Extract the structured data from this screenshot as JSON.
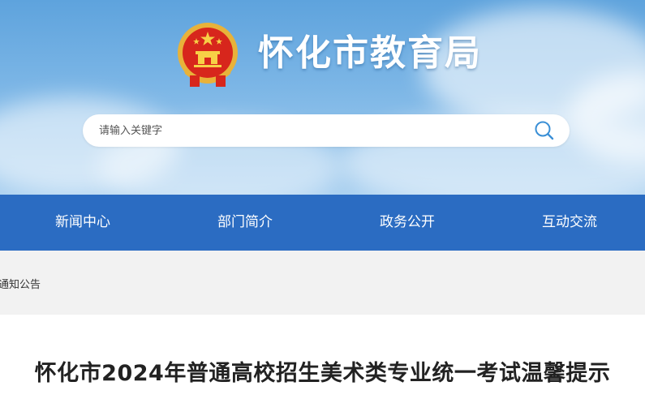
{
  "header": {
    "site_title": "怀化市教育局",
    "emblem_icon": "national-emblem-icon"
  },
  "search": {
    "placeholder": "请输入关键字",
    "button_icon": "search-icon"
  },
  "nav": {
    "items": [
      {
        "label": "新闻中心"
      },
      {
        "label": "部门简介"
      },
      {
        "label": "政务公开"
      },
      {
        "label": "互动交流"
      }
    ]
  },
  "breadcrumb": {
    "text": "通知公告"
  },
  "article": {
    "title": "怀化市2024年普通高校招生美术类专业统一考试温馨提示"
  },
  "colors": {
    "nav_bg": "#2b6cc2",
    "crumb_bg": "#f2f2f2",
    "header_sky": "#6eaee3"
  }
}
